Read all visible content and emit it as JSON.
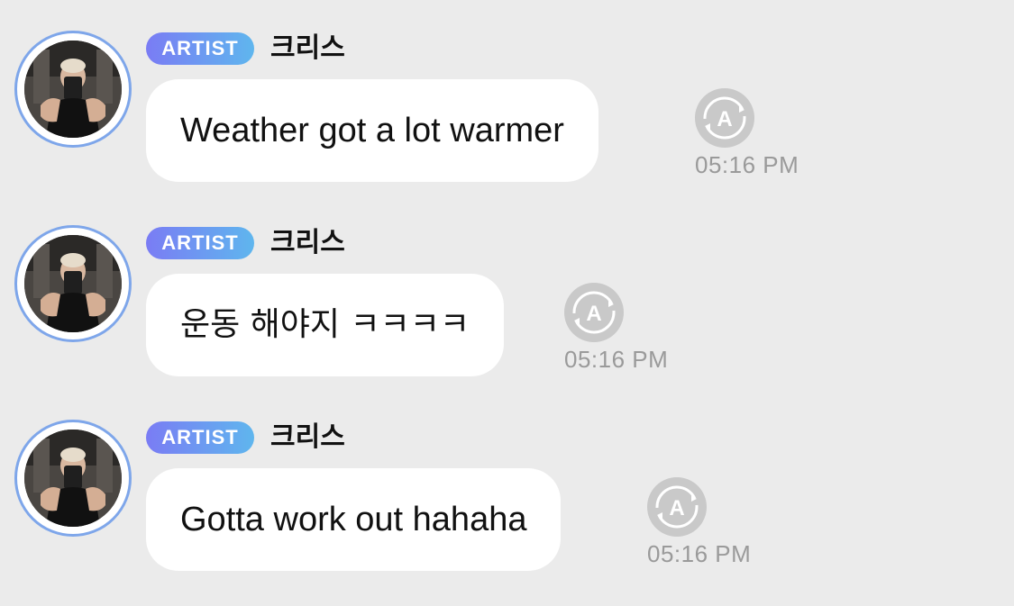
{
  "messages": [
    {
      "badge": "ARTIST",
      "sender": "크리스",
      "text": "Weather got a lot warmer",
      "time": "05:16 PM"
    },
    {
      "badge": "ARTIST",
      "sender": "크리스",
      "text": "운동 해야지 ㅋㅋㅋㅋ",
      "time": "05:16 PM"
    },
    {
      "badge": "ARTIST",
      "sender": "크리스",
      "text": "Gotta work out hahaha",
      "time": "05:16 PM"
    }
  ],
  "icons": {
    "translate": "translate-icon"
  },
  "colors": {
    "background": "#ebebeb",
    "badge_gradient_start": "#7a7cf4",
    "badge_gradient_end": "#5fb6ee",
    "avatar_ring": "#7ea6ea",
    "bubble": "#ffffff",
    "timestamp": "#9a9a9a",
    "translate_icon_bg": "#c9c9c9"
  }
}
